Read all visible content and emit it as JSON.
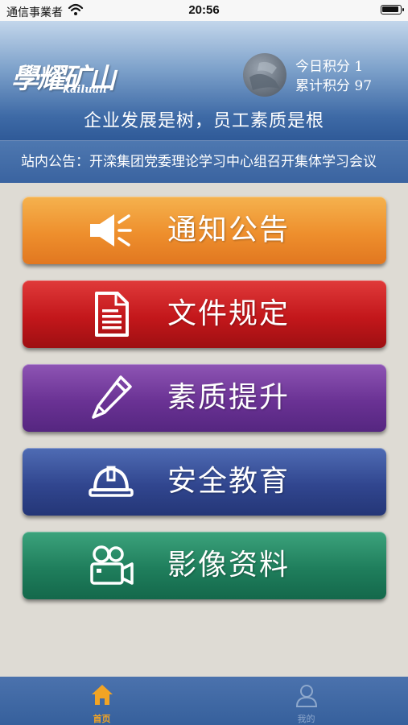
{
  "status_bar": {
    "carrier": "通信事業者",
    "time": "20:56"
  },
  "header": {
    "logo_cn": "學耀矿山",
    "logo_en": "kailuan",
    "score_today": "今日积分 1",
    "score_total": "累计积分 97",
    "slogan": "企业发展是树，员工素质是根"
  },
  "announcement": {
    "text": "站内公告：开滦集团党委理论学习中心组召开集体学习会议"
  },
  "menu": [
    {
      "label": "通知公告",
      "icon": "megaphone-icon"
    },
    {
      "label": "文件规定",
      "icon": "document-icon"
    },
    {
      "label": "素质提升",
      "icon": "pen-icon"
    },
    {
      "label": "安全教育",
      "icon": "hardhat-icon"
    },
    {
      "label": "影像资料",
      "icon": "video-camera-icon"
    }
  ],
  "tabbar": {
    "home": {
      "label": "首页",
      "icon": "home-icon",
      "active": true
    },
    "mine": {
      "label": "我的",
      "icon": "person-icon",
      "active": false
    }
  },
  "colors": {
    "header_blue": "#3e6aa6",
    "notice_orange": "#ee8f2d",
    "files_red": "#c3171b",
    "quality_purple": "#6a3294",
    "safety_blue": "#31468f",
    "media_green": "#1f7e5c",
    "tab_active": "#f2a424"
  }
}
